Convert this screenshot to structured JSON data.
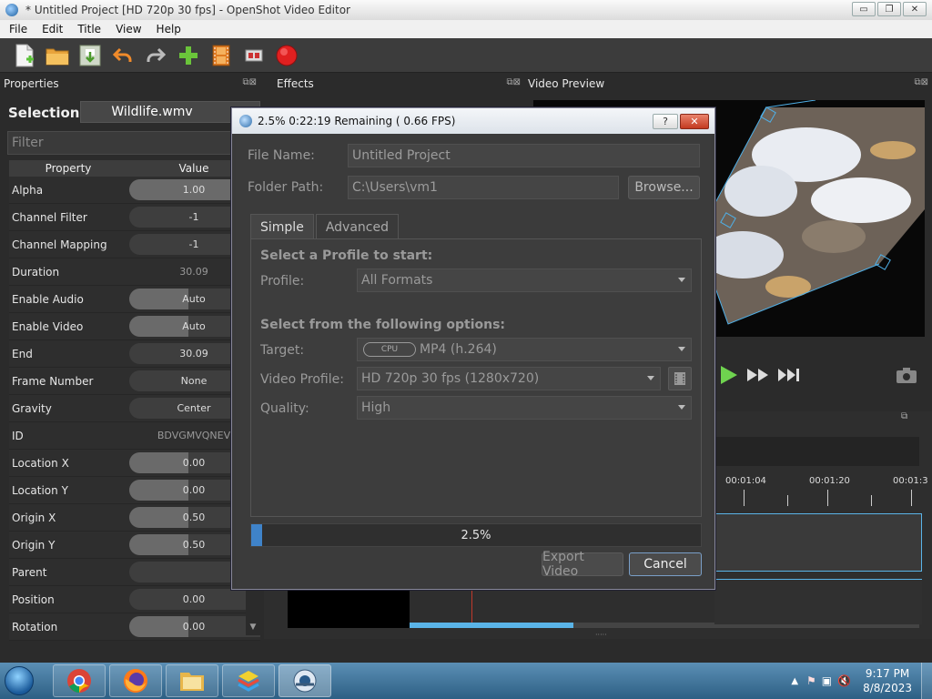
{
  "window": {
    "title": "* Untitled Project [HD 720p 30 fps] - OpenShot Video Editor",
    "min": "▭",
    "max": "❐",
    "close": "✕"
  },
  "menu": [
    "File",
    "Edit",
    "Title",
    "View",
    "Help"
  ],
  "docks": {
    "properties": "Properties",
    "effects": "Effects",
    "video_preview": "Video Preview"
  },
  "properties": {
    "selection_label": "Selection:",
    "selection_value": "Wildlife.wmv",
    "filter_placeholder": "Filter",
    "headers": [
      "Property",
      "Value"
    ],
    "rows": [
      {
        "name": "Alpha",
        "value": "1.00",
        "fill": 1.0
      },
      {
        "name": "Channel Filter",
        "value": "-1",
        "fill": 0
      },
      {
        "name": "Channel Mapping",
        "value": "-1",
        "fill": 0
      },
      {
        "name": "Duration",
        "value": "30.09",
        "fill": null
      },
      {
        "name": "Enable Audio",
        "value": "Auto",
        "fill": 0.45
      },
      {
        "name": "Enable Video",
        "value": "Auto",
        "fill": 0.45
      },
      {
        "name": "End",
        "value": "30.09",
        "fill": 0
      },
      {
        "name": "Frame Number",
        "value": "None",
        "fill": 0
      },
      {
        "name": "Gravity",
        "value": "Center",
        "fill": 0
      },
      {
        "name": "ID",
        "value": "BDVGMVQNEV",
        "fill": null
      },
      {
        "name": "Location X",
        "value": "0.00",
        "fill": 0.45
      },
      {
        "name": "Location Y",
        "value": "0.00",
        "fill": 0.45
      },
      {
        "name": "Origin X",
        "value": "0.50",
        "fill": 0.45
      },
      {
        "name": "Origin Y",
        "value": "0.50",
        "fill": 0.45
      },
      {
        "name": "Parent",
        "value": "",
        "fill": 0
      },
      {
        "name": "Position",
        "value": "0.00",
        "fill": 0
      },
      {
        "name": "Rotation",
        "value": "0.00",
        "fill": 0.45
      }
    ]
  },
  "timeline": {
    "ticks": [
      "00:01:04",
      "00:01:20",
      "00:01:3"
    ]
  },
  "dialog": {
    "title": "2.5%  0:22:19 Remaining ( 0.66 FPS)",
    "help": "?",
    "close": "✕",
    "file_name_label": "File Name:",
    "file_name_value": "Untitled Project",
    "folder_path_label": "Folder Path:",
    "folder_path_value": "C:\\Users\\vm1",
    "browse": "Browse...",
    "tabs": [
      "Simple",
      "Advanced"
    ],
    "section_profile": "Select a Profile to start:",
    "profile_label": "Profile:",
    "profile_value": "All Formats",
    "section_options": "Select from the following options:",
    "target_label": "Target:",
    "target_badge": "CPU",
    "target_value": "MP4 (h.264)",
    "video_profile_label": "Video Profile:",
    "video_profile_value": "HD 720p 30 fps (1280x720)",
    "quality_label": "Quality:",
    "quality_value": "High",
    "progress_text": "2.5%",
    "progress": 0.025,
    "export_button": "Export Video",
    "cancel_button": "Cancel"
  },
  "taskbar": {
    "time": "9:17 PM",
    "date": "8/8/2023"
  },
  "colors": {
    "accent": "#3f83c9",
    "timeline_blue": "#5ab4e8",
    "play_green": "#6fd34f"
  }
}
